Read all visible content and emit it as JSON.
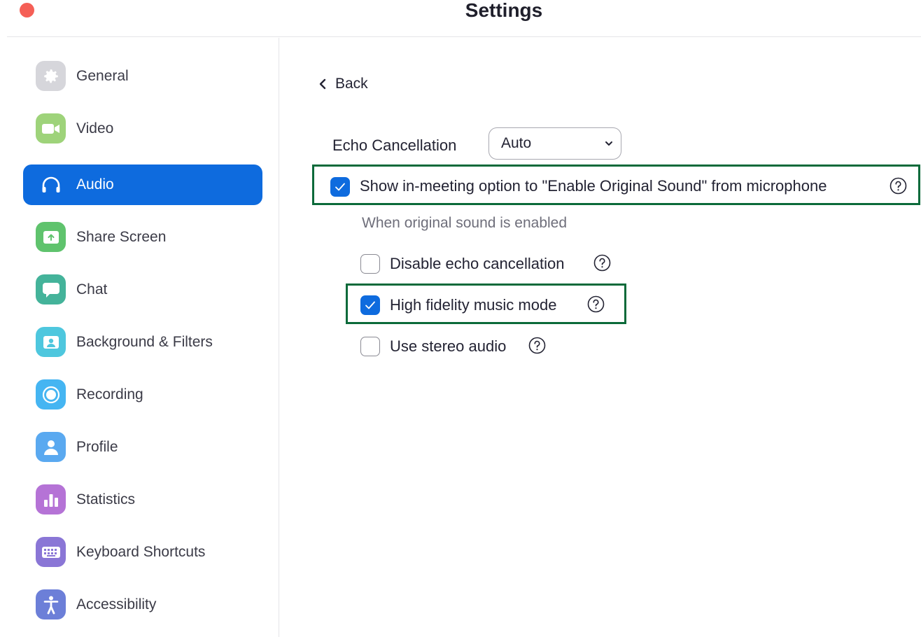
{
  "window": {
    "title": "Settings",
    "close_color": "#f55f56"
  },
  "sidebar": {
    "accent": "#0e6bde",
    "items": [
      {
        "key": "general",
        "label": "General",
        "icon": "gear-icon",
        "color": "#d6d6db",
        "active": false
      },
      {
        "key": "video",
        "label": "Video",
        "icon": "camera-icon",
        "color": "#9ed37a",
        "active": false
      },
      {
        "key": "audio",
        "label": "Audio",
        "icon": "headphones-icon",
        "color": "#0e6bde",
        "active": true
      },
      {
        "key": "share-screen",
        "label": "Share Screen",
        "icon": "share-screen-icon",
        "color": "#5fc36d",
        "active": false
      },
      {
        "key": "chat",
        "label": "Chat",
        "icon": "chat-bubble-icon",
        "color": "#44b39a",
        "active": false
      },
      {
        "key": "background-filters",
        "label": "Background & Filters",
        "icon": "background-person-icon",
        "color": "#4ec7de",
        "active": false
      },
      {
        "key": "recording",
        "label": "Recording",
        "icon": "record-icon",
        "color": "#45b5f2",
        "active": false
      },
      {
        "key": "profile",
        "label": "Profile",
        "icon": "person-icon",
        "color": "#5aa9f0",
        "active": false
      },
      {
        "key": "statistics",
        "label": "Statistics",
        "icon": "bar-chart-icon",
        "color": "#b573d6",
        "active": false
      },
      {
        "key": "keyboard-shortcuts",
        "label": "Keyboard Shortcuts",
        "icon": "keyboard-icon",
        "color": "#8a76d6",
        "active": false
      },
      {
        "key": "accessibility",
        "label": "Accessibility",
        "icon": "accessibility-icon",
        "color": "#6c7fd8",
        "active": false
      }
    ]
  },
  "main": {
    "back_label": "Back",
    "echo_cancellation": {
      "label": "Echo Cancellation",
      "selected": "Auto"
    },
    "original_sound": {
      "label": "Show in-meeting option to \"Enable Original Sound\" from microphone",
      "checked": true
    },
    "sub_heading": "When original sound is enabled",
    "options": [
      {
        "key": "disable-echo",
        "label": "Disable echo cancellation",
        "checked": false
      },
      {
        "key": "high-fidelity",
        "label": "High fidelity music mode",
        "checked": true
      },
      {
        "key": "stereo",
        "label": "Use stereo audio",
        "checked": false
      }
    ],
    "highlight_color": "#0b6a3a"
  }
}
